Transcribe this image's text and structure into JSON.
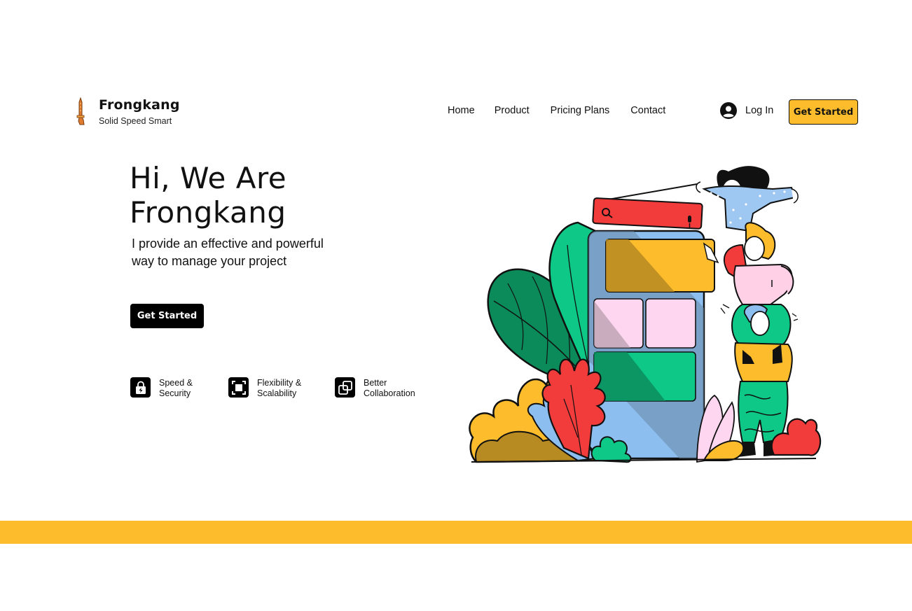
{
  "header": {
    "brand_name": "Frongkang",
    "brand_tagline": "Solid Speed Smart",
    "nav": [
      "Home",
      "Product",
      "Pricing Plans",
      "Contact"
    ],
    "login_label": "Log In",
    "cta_label": "Get Started"
  },
  "hero": {
    "title_line1": "Hi, We Are",
    "title_line2": "Frongkang",
    "subtitle_line1": "I provide an effective and powerful",
    "subtitle_line2": "way to manage your project",
    "cta_label": "Get Started"
  },
  "features": [
    {
      "line1": "Speed &",
      "line2": "Security",
      "icon": "lock-bolt-icon"
    },
    {
      "line1": "Flexibility &",
      "line2": "Scalability",
      "icon": "scale-square-icon"
    },
    {
      "line1": "Better",
      "line2": "Collaboration",
      "icon": "overlap-squares-icon"
    }
  ],
  "colors": {
    "accent": "#fdbc2c",
    "dark": "#000000",
    "red": "#f23b3b",
    "green": "#0dc886",
    "blue": "#8dbef0",
    "pink": "#ffd6ef"
  }
}
